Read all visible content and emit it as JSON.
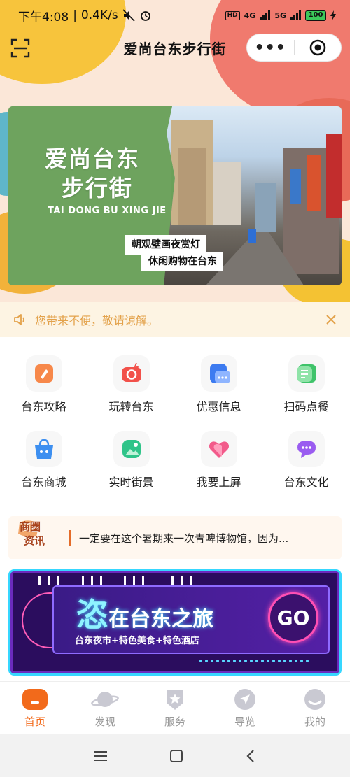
{
  "status": {
    "time": "下午4:08",
    "speed": "0.4K/s",
    "network1": "4G",
    "network2": "5G",
    "battery": "100",
    "hd": "HD"
  },
  "nav": {
    "title": "爱尚台东步行街",
    "more_label": "•••"
  },
  "banner": {
    "title_line1": "爱尚台东",
    "title_line2": "步行街",
    "pinyin": "TAI DONG BU XING JIE",
    "tag1": "朝观壁画夜赏灯",
    "tag2": "休闲购物在台东"
  },
  "notice": {
    "text": "您带来不便，敬请谅解。"
  },
  "grid": [
    {
      "label": "台东攻略",
      "icon": "guide-icon",
      "color": "#f47a3c"
    },
    {
      "label": "玩转台东",
      "icon": "camera-icon",
      "color": "#f2514a"
    },
    {
      "label": "优惠信息",
      "icon": "coupon-icon",
      "color": "#3d7bf0"
    },
    {
      "label": "扫码点餐",
      "icon": "scan-order-icon",
      "color": "#3fc36a"
    },
    {
      "label": "台东商城",
      "icon": "shopping-bag-icon",
      "color": "#3d8ff0"
    },
    {
      "label": "实时街景",
      "icon": "street-view-icon",
      "color": "#2fc489"
    },
    {
      "label": "我要上屏",
      "icon": "heart-icon",
      "color": "#f25a8a"
    },
    {
      "label": "台东文化",
      "icon": "chat-bubble-icon",
      "color": "#9a5cf0"
    }
  ],
  "news": {
    "badge_line1": "商圈",
    "badge_line2": "资讯",
    "text": "一定要在这个暑期来一次青啤博物馆，因为..."
  },
  "promo": {
    "title_big": "恣",
    "title_rest": "在台东之旅",
    "subtitle": "台东夜市+特色美食+特色酒店",
    "go": "GO"
  },
  "tabs": [
    {
      "label": "首页",
      "icon": "home-icon",
      "active": true
    },
    {
      "label": "发现",
      "icon": "planet-icon",
      "active": false
    },
    {
      "label": "服务",
      "icon": "star-shield-icon",
      "active": false
    },
    {
      "label": "导览",
      "icon": "navigation-icon",
      "active": false
    },
    {
      "label": "我的",
      "icon": "profile-icon",
      "active": false
    }
  ],
  "colors": {
    "accent": "#f26a1b",
    "notice_text": "#e3a24b",
    "tab_inactive": "#9a9a9a"
  }
}
